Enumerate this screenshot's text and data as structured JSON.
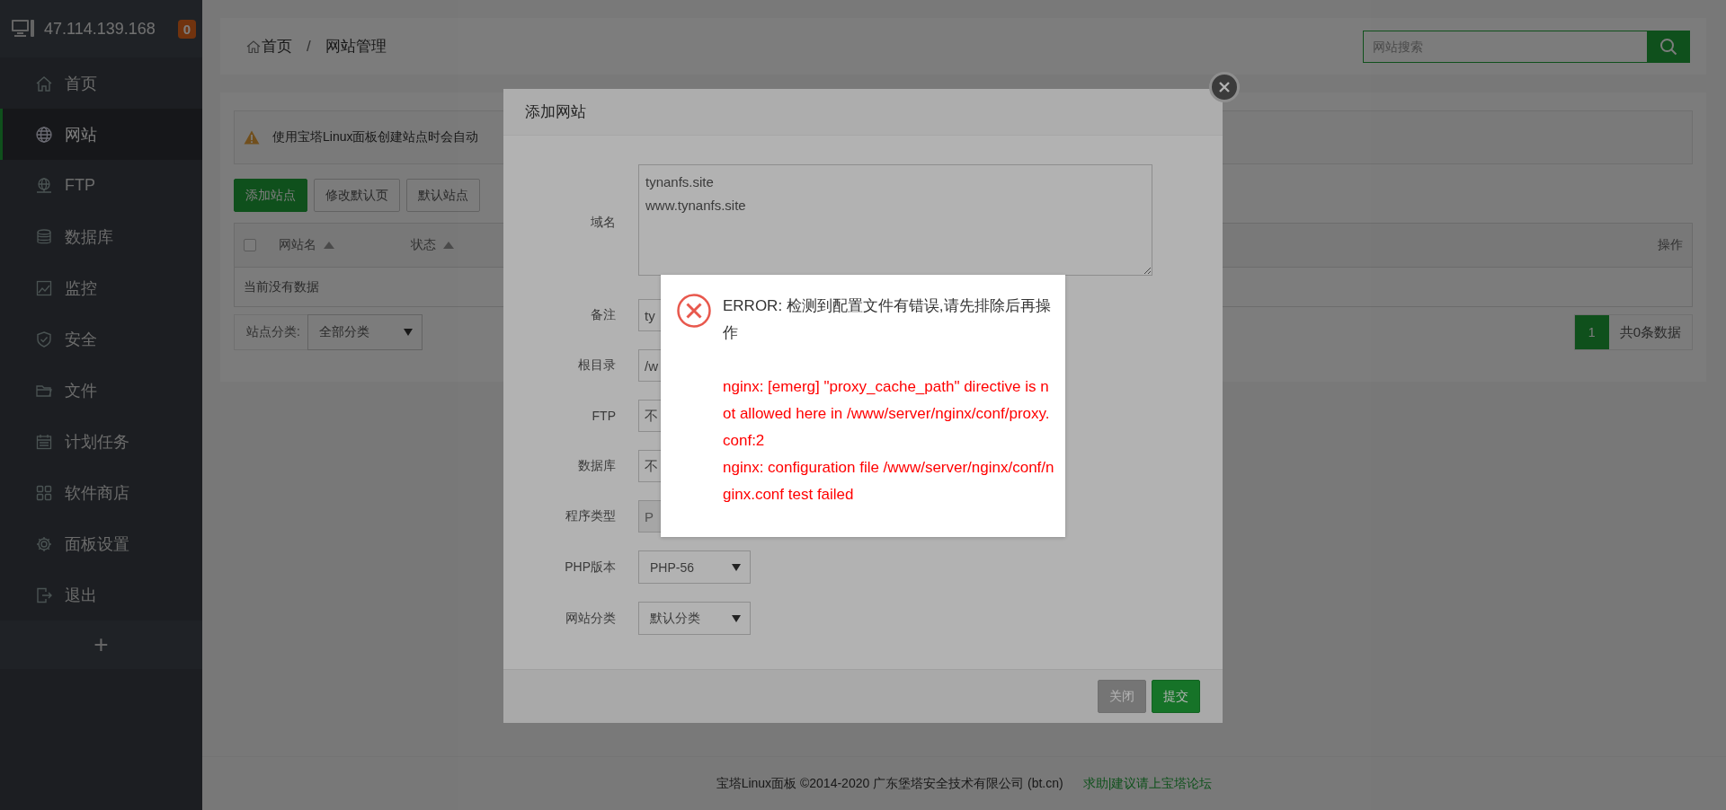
{
  "sidebar": {
    "host": "47.114.139.168",
    "badge": "0",
    "items": [
      {
        "label": "首页",
        "selected": false
      },
      {
        "label": "网站",
        "selected": true
      },
      {
        "label": "FTP",
        "selected": false
      },
      {
        "label": "数据库",
        "selected": false
      },
      {
        "label": "监控",
        "selected": false
      },
      {
        "label": "安全",
        "selected": false
      },
      {
        "label": "文件",
        "selected": false
      },
      {
        "label": "计划任务",
        "selected": false
      },
      {
        "label": "软件商店",
        "selected": false
      },
      {
        "label": "面板设置",
        "selected": false
      },
      {
        "label": "退出",
        "selected": false
      }
    ],
    "add_button": "+"
  },
  "breadcrumb": {
    "items": [
      "首页",
      "网站管理"
    ],
    "separator": "/"
  },
  "search": {
    "placeholder": "网站搜索"
  },
  "notice": {
    "text": "使用宝塔Linux面板创建站点时会自动"
  },
  "toolbar_buttons": [
    {
      "label": "添加站点",
      "kind": "primary"
    },
    {
      "label": "修改默认页",
      "kind": "default"
    },
    {
      "label": "默认站点",
      "kind": "default"
    }
  ],
  "table": {
    "select_all": {
      "checked": false
    },
    "columns": [
      {
        "label": "网站名",
        "sortable": true
      },
      {
        "label": "状态",
        "sortable": true
      },
      {
        "label": "操作",
        "sortable": false
      }
    ],
    "empty_text": "当前没有数据"
  },
  "category_filter": {
    "label": "站点分类:",
    "value": "全部分类"
  },
  "pagination": {
    "pages": [
      {
        "label": "1",
        "selected": true
      }
    ],
    "total": "共0条数据"
  },
  "footer": {
    "copyright": "宝塔Linux面板 ©2014-2020 广东堡塔安全技术有限公司 (bt.cn)",
    "link": "求助|建议请上宝塔论坛"
  },
  "modal": {
    "title": "添加网站",
    "fields": [
      {
        "label": "域名",
        "kind": "textarea",
        "value": "tynanfs.site\nwww.tynanfs.site"
      },
      {
        "label": "备注",
        "kind": "input",
        "value": "ty",
        "disabled": false
      },
      {
        "label": "根目录",
        "kind": "input",
        "value": "/w",
        "disabled": false
      },
      {
        "label": "FTP",
        "kind": "input",
        "value": "不",
        "disabled": false
      },
      {
        "label": "数据库",
        "kind": "input",
        "value": "不",
        "disabled": false
      },
      {
        "label": "程序类型",
        "kind": "input",
        "value": "P",
        "disabled": true
      },
      {
        "label": "PHP版本",
        "kind": "select",
        "value": "PHP-56"
      },
      {
        "label": "网站分类",
        "kind": "select",
        "value": "默认分类"
      }
    ],
    "buttons": [
      {
        "label": "关闭",
        "kind": "secondary"
      },
      {
        "label": "提交",
        "kind": "primary"
      }
    ]
  },
  "error_dialog": {
    "message": "ERROR: 检测到配置文件有错误,请先排除后再操作",
    "details": [
      "nginx: [emerg] \"proxy_cache_path\" directive is not allowed here in /www/server/nginx/conf/proxy.conf:2",
      "nginx: configuration file /www/server/nginx/conf/nginx.conf test failed"
    ]
  }
}
